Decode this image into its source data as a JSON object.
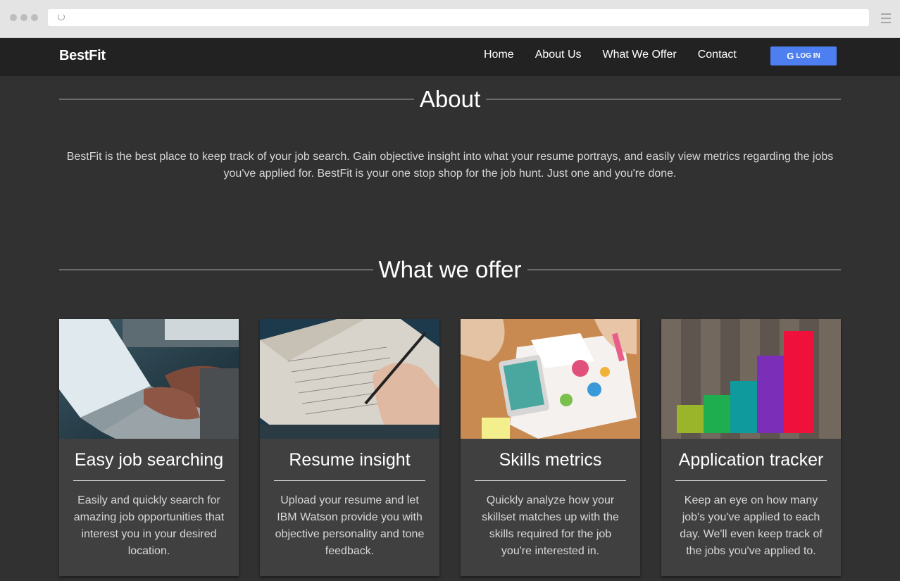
{
  "brand": "BestFit",
  "nav": {
    "links": [
      "Home",
      "About Us",
      "What We Offer",
      "Contact"
    ],
    "login": "LOG IN",
    "login_icon": "G"
  },
  "about": {
    "title": "About",
    "text": "BestFit is the best place to keep track of your job search. Gain objective insight into what your resume portrays, and easily view metrics regarding the jobs you've applied for. BestFit is your one stop shop for the job hunt. Just one and you're done."
  },
  "offer": {
    "title": "What we offer",
    "cards": [
      {
        "title": "Easy job searching",
        "text": "Easily and quickly search for amazing job opportunities that interest you in your desired location.",
        "image": "laptop-typing-photo"
      },
      {
        "title": "Resume insight",
        "text": "Upload your resume and let IBM Watson provide you with objective personality and tone feedback.",
        "image": "notebook-writing-photo"
      },
      {
        "title": "Skills metrics",
        "text": "Quickly analyze how your skillset matches up with the skills required for the job you're interested in.",
        "image": "charts-phone-desk-photo"
      },
      {
        "title": "Application tracker",
        "text": "Keep an eye on how many job's you've applied to each day. We'll even keep track of the jobs you've applied to.",
        "image": "colored-bar-blocks-photo"
      }
    ]
  },
  "colors": {
    "login_button": "#4d7ff0",
    "page_bg": "#313131",
    "navbar_bg": "#222222",
    "card_bg": "#404040"
  }
}
